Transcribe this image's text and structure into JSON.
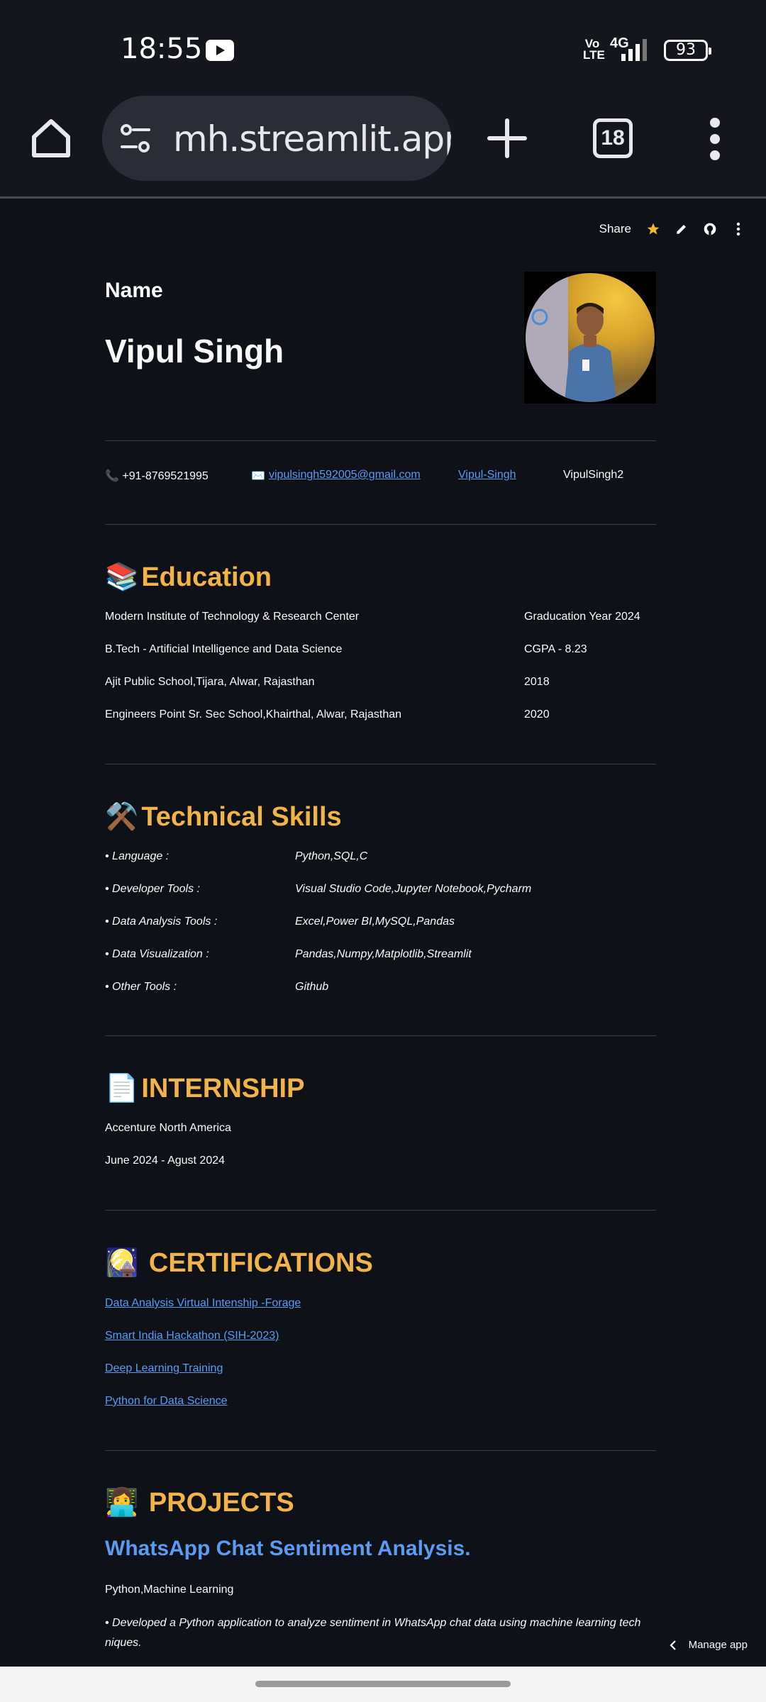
{
  "status_bar": {
    "time": "18:55",
    "volte": "Vo LTE",
    "network": "4G",
    "battery": "93"
  },
  "browser": {
    "url": "mh.streamlit.app",
    "tab_count": "18"
  },
  "toolbar": {
    "share_label": "Share"
  },
  "header": {
    "name_label": "Name",
    "name_value": "Vipul Singh"
  },
  "contact": {
    "phone": "📞 +91-8769521995",
    "email_prefix": "✉️",
    "email": "vipulsingh592005@gmail.com",
    "linkedin": "Vipul-Singh",
    "github": "VipulSingh2"
  },
  "education": {
    "emoji": "📚",
    "title": "Education",
    "rows": [
      {
        "left": "Modern Institute of Technology & Research Center",
        "right": "Graducation Year 2024"
      },
      {
        "left": "B.Tech - Artificial Intelligence and Data Science",
        "right": "CGPA - 8.23"
      },
      {
        "left": "Ajit Public School,Tijara, Alwar, Rajasthan",
        "right": "2018"
      },
      {
        "left": "Engineers Point Sr. Sec School,Khairthal, Alwar, Rajasthan",
        "right": "2020"
      }
    ]
  },
  "skills": {
    "emoji": "⚒️",
    "title": "Technical Skills",
    "rows": [
      {
        "label": "• Language :",
        "value": "Python,SQL,C"
      },
      {
        "label": "• Developer Tools :",
        "value": "Visual Studio Code,Jupyter Notebook,Pycharm"
      },
      {
        "label": "• Data Analysis Tools :",
        "value": "Excel,Power BI,MySQL,Pandas"
      },
      {
        "label": "• Data Visualization :",
        "value": "Pandas,Numpy,Matplotlib,Streamlit"
      },
      {
        "label": "• Other Tools :",
        "value": "Github"
      }
    ]
  },
  "internship": {
    "emoji": "📄",
    "title": "INTERNSHIP",
    "company": "Accenture North America",
    "period": "June 2024 - Agust 2024"
  },
  "certifications": {
    "emoji": "🎑",
    "title": "CERTIFICATIONS",
    "items": [
      "Data Analysis Virtual Intenship -Forage",
      "Smart India Hackathon (SIH-2023)",
      "Deep Learning Training",
      "Python for Data Science"
    ]
  },
  "projects": {
    "emoji": "👩‍💻",
    "title": "PROJECTS",
    "first_title": "WhatsApp Chat Sentiment Analysis.",
    "first_stack": "Python,Machine Learning",
    "first_desc": "• Developed a Python application to analyze sentiment in WhatsApp chat data using machine learning tech niques."
  },
  "manage_app_label": "Manage app",
  "colors": {
    "background": "#0e1117",
    "section_title": "#f2b449",
    "link": "#5a9cf2",
    "divider": "#3a3d45",
    "star": "#f5b82e"
  }
}
